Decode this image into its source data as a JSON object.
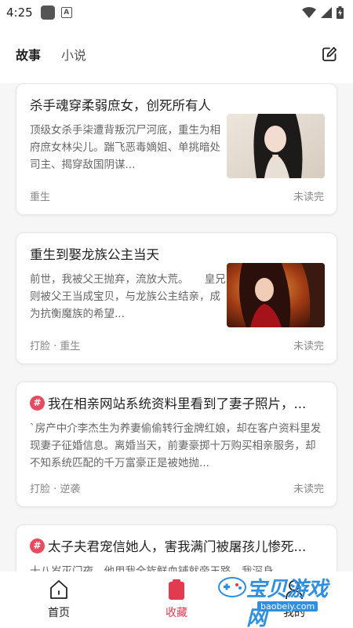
{
  "status_bar": {
    "time": "4:25"
  },
  "header": {
    "tabs": [
      {
        "label": "故事"
      },
      {
        "label": "小说"
      }
    ]
  },
  "cards": [
    {
      "title": "杀手魂穿柔弱庶女，创死所有人",
      "desc": "顶级女杀手柒遭背叛沉尸河底，重生为相府庶女林尖儿。踹飞恶毒嫡姐、单挑暗处司主、揭穿敌国阴谋...",
      "tags": "重生",
      "status": "未读完"
    },
    {
      "title": "重生到娶龙族公主当天",
      "desc": "前世，我被父王抛弃，流放大荒。　　皇兄则被父王当成宝贝，与龙族公主结亲，成为抗衡魔族的希望...",
      "tags": "打脸 · 重生",
      "status": "未读完"
    },
    {
      "title": "我在相亲网站系统资料里看到了妻子照片，...",
      "desc": "`房产中介李杰生为养妻偷偷转行金牌红娘，却在客户资料里发现妻子征婚信息。离婚当天，前妻豪掷十万购买相亲服务，却不知系统匹配的千万富豪正是被她抛...",
      "tags": "打脸 · 逆袭",
      "status": "未读完"
    },
    {
      "title": "太子夫君宠信她人，害我满门被屠孩儿惨死...",
      "desc": "十八岁灭门夜，他用我全族鲜血铺就帝王路，我深身..."
    }
  ],
  "bottom_nav": [
    {
      "label": "首页"
    },
    {
      "label": "收藏"
    },
    {
      "label": "我的"
    }
  ],
  "watermark": {
    "text": "宝贝游戏网",
    "url": "baobeiy.com"
  },
  "colors": {
    "accent": "#e23a4e",
    "hash_badge": "#e84a5f",
    "watermark": "#2f8fe0"
  }
}
